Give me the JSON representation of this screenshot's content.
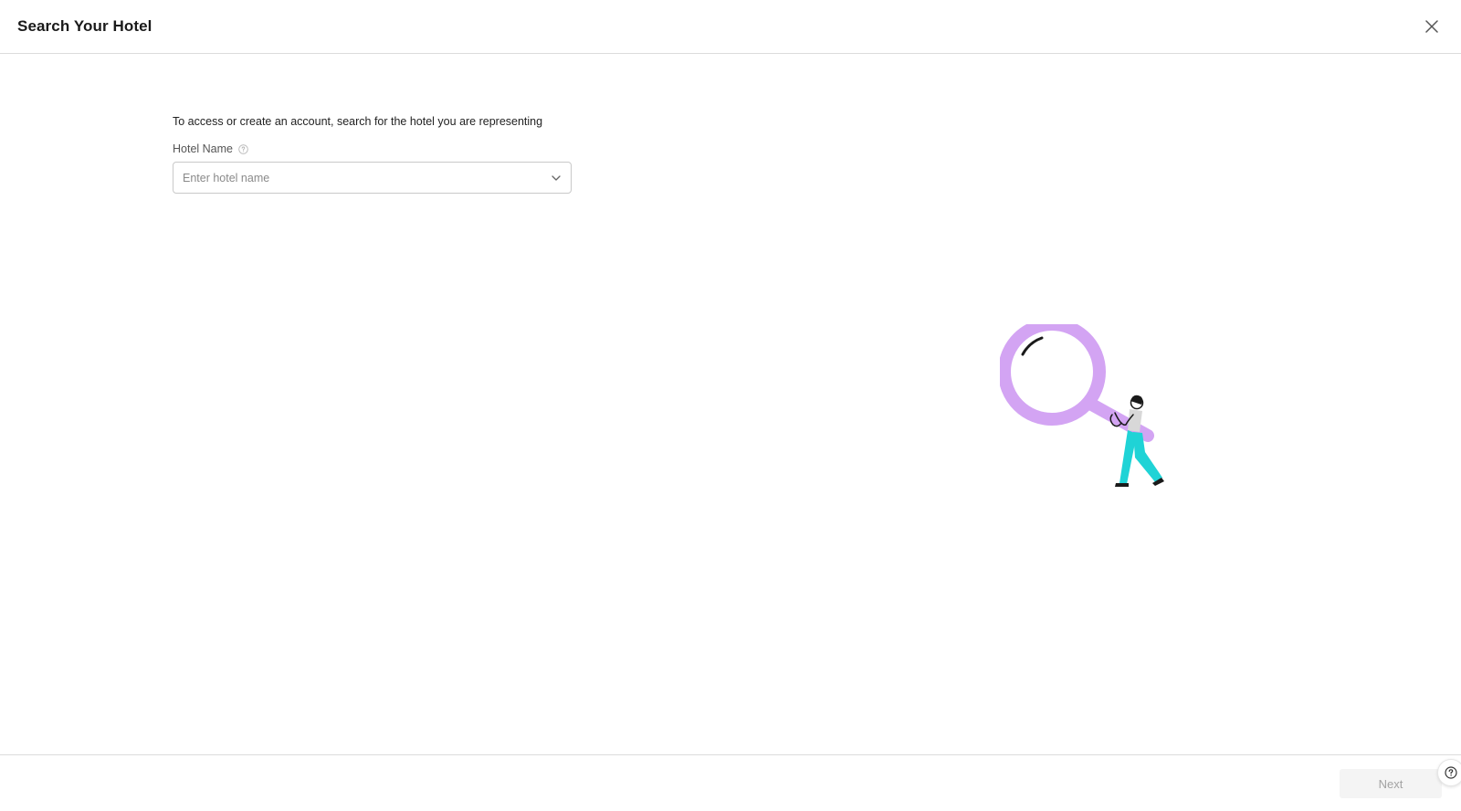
{
  "header": {
    "title": "Search Your Hotel",
    "close_icon": "close-icon"
  },
  "main": {
    "intro_text": "To access or create an account, search for the hotel you are representing",
    "hotel_field": {
      "label": "Hotel Name",
      "info_icon": "info-icon",
      "placeholder": "Enter hotel name",
      "value": "",
      "dropdown_icon": "chevron-down-icon"
    }
  },
  "illustration": {
    "name": "person-with-magnifying-glass-illustration",
    "colors": {
      "lens": "#d3a4f3",
      "pants": "#1fd3d6",
      "ink": "#1a1a1a"
    }
  },
  "footer": {
    "next_label": "Next",
    "next_enabled": false,
    "help_icon": "help-icon"
  }
}
